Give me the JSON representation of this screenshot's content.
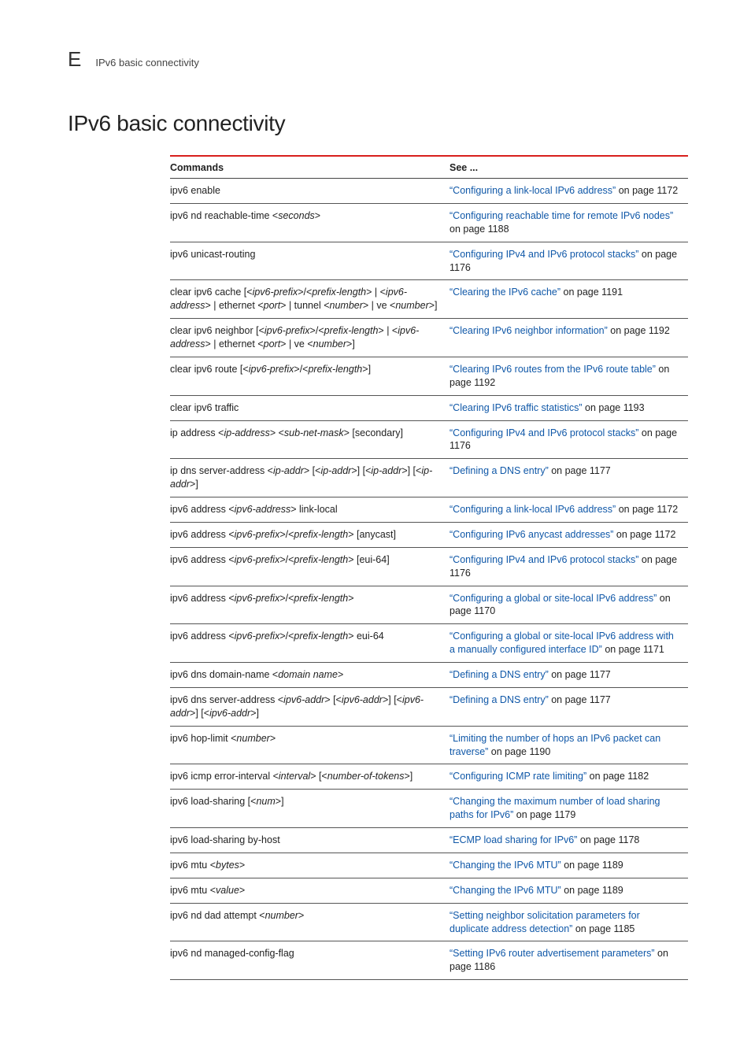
{
  "header": {
    "appendix_letter": "E",
    "subtitle": "IPv6 basic connectivity"
  },
  "title": "IPv6 basic connectivity",
  "table": {
    "headers": {
      "commands": "Commands",
      "see": "See ..."
    },
    "rows": [
      {
        "cmd": [
          {
            "t": "ipv6 enable"
          }
        ],
        "see": [
          {
            "l": "“Configuring a link-local IPv6 address”"
          },
          {
            "t": " on page 1172"
          }
        ]
      },
      {
        "cmd": [
          {
            "t": "ipv6 nd reachable-time <"
          },
          {
            "i": "seconds"
          },
          {
            "t": ">"
          }
        ],
        "see": [
          {
            "l": "“Configuring reachable time for remote IPv6 nodes”"
          },
          {
            "t": " on page 1188"
          }
        ]
      },
      {
        "cmd": [
          {
            "t": "ipv6 unicast-routing"
          }
        ],
        "see": [
          {
            "l": "“Configuring IPv4 and IPv6 protocol stacks”"
          },
          {
            "t": " on page 1176"
          }
        ]
      },
      {
        "cmd": [
          {
            "t": "clear ipv6 cache [<"
          },
          {
            "i": "ipv6-prefix"
          },
          {
            "t": ">/<"
          },
          {
            "i": "prefix-length"
          },
          {
            "t": "> | <"
          },
          {
            "i": "ipv6-address"
          },
          {
            "t": "> | ethernet <"
          },
          {
            "i": "port"
          },
          {
            "t": "> | tunnel <"
          },
          {
            "i": "number"
          },
          {
            "t": "> | ve <"
          },
          {
            "i": "number"
          },
          {
            "t": ">]"
          }
        ],
        "see": [
          {
            "l": "“Clearing the IPv6 cache”"
          },
          {
            "t": " on page 1191"
          }
        ]
      },
      {
        "cmd": [
          {
            "t": "clear ipv6 neighbor [<"
          },
          {
            "i": "ipv6-prefix"
          },
          {
            "t": ">/<"
          },
          {
            "i": "prefix-length"
          },
          {
            "t": "> | <"
          },
          {
            "i": "ipv6-address"
          },
          {
            "t": "> | ethernet <"
          },
          {
            "i": "port"
          },
          {
            "t": "> | ve <"
          },
          {
            "i": "number"
          },
          {
            "t": ">]"
          }
        ],
        "see": [
          {
            "l": "“Clearing IPv6 neighbor information”"
          },
          {
            "t": " on page 1192"
          }
        ]
      },
      {
        "cmd": [
          {
            "t": "clear ipv6 route [<"
          },
          {
            "i": "ipv6-prefix"
          },
          {
            "t": ">/<"
          },
          {
            "i": "prefix-length"
          },
          {
            "t": ">]"
          }
        ],
        "see": [
          {
            "l": "“Clearing IPv6 routes from the IPv6 route table”"
          },
          {
            "t": " on page 1192"
          }
        ]
      },
      {
        "cmd": [
          {
            "t": "clear ipv6 traffic"
          }
        ],
        "see": [
          {
            "l": "“Clearing IPv6 traffic statistics”"
          },
          {
            "t": " on page 1193"
          }
        ]
      },
      {
        "cmd": [
          {
            "t": "ip address <"
          },
          {
            "i": "ip-address"
          },
          {
            "t": "> <"
          },
          {
            "i": "sub-net-mask"
          },
          {
            "t": "> [secondary]"
          }
        ],
        "see": [
          {
            "l": "“Configuring IPv4 and IPv6 protocol stacks”"
          },
          {
            "t": " on page 1176"
          }
        ]
      },
      {
        "cmd": [
          {
            "t": "ip dns server-address <"
          },
          {
            "i": "ip-addr"
          },
          {
            "t": "> [<"
          },
          {
            "i": "ip-addr"
          },
          {
            "t": ">] [<"
          },
          {
            "i": "ip-addr"
          },
          {
            "t": ">] [<"
          },
          {
            "i": "ip-addr"
          },
          {
            "t": ">]"
          }
        ],
        "see": [
          {
            "l": "“Defining a DNS entry”"
          },
          {
            "t": " on page 1177"
          }
        ]
      },
      {
        "cmd": [
          {
            "t": "ipv6 address <"
          },
          {
            "i": "ipv6-address"
          },
          {
            "t": "> link-local"
          }
        ],
        "see": [
          {
            "l": "“Configuring a link-local IPv6 address”"
          },
          {
            "t": " on page 1172"
          }
        ]
      },
      {
        "cmd": [
          {
            "t": "ipv6 address <"
          },
          {
            "i": "ipv6-prefix"
          },
          {
            "t": ">/<"
          },
          {
            "i": "prefix-length"
          },
          {
            "t": "> [anycast]"
          }
        ],
        "see": [
          {
            "l": "“Configuring IPv6 anycast addresses”"
          },
          {
            "t": " on page 1172"
          }
        ]
      },
      {
        "cmd": [
          {
            "t": "ipv6 address <"
          },
          {
            "i": "ipv6-prefix"
          },
          {
            "t": ">/<"
          },
          {
            "i": "prefix-length"
          },
          {
            "t": "> [eui-64]"
          }
        ],
        "see": [
          {
            "l": "“Configuring IPv4 and IPv6 protocol stacks”"
          },
          {
            "t": " on page 1176"
          }
        ]
      },
      {
        "cmd": [
          {
            "t": "ipv6 address <"
          },
          {
            "i": "ipv6-prefix"
          },
          {
            "t": ">/<"
          },
          {
            "i": "prefix-length"
          },
          {
            "t": ">"
          }
        ],
        "see": [
          {
            "l": "“Configuring a global or site-local IPv6 address”"
          },
          {
            "t": " on page 1170"
          }
        ]
      },
      {
        "cmd": [
          {
            "t": "ipv6 address <"
          },
          {
            "i": "ipv6-prefix"
          },
          {
            "t": ">/<"
          },
          {
            "i": "prefix-length"
          },
          {
            "t": "> eui-64"
          }
        ],
        "see": [
          {
            "l": "“Configuring a global or site-local IPv6 address with a manually configured interface ID”"
          },
          {
            "t": " on page 1171"
          }
        ]
      },
      {
        "cmd": [
          {
            "t": "ipv6 dns domain-name <"
          },
          {
            "i": "domain name"
          },
          {
            "t": ">"
          }
        ],
        "see": [
          {
            "l": "“Defining a DNS entry”"
          },
          {
            "t": " on page 1177"
          }
        ]
      },
      {
        "cmd": [
          {
            "t": "ipv6 dns server-address <"
          },
          {
            "i": "ipv6-addr"
          },
          {
            "t": "> [<"
          },
          {
            "i": "ipv6-addr"
          },
          {
            "t": ">] [<"
          },
          {
            "i": "ipv6-addr"
          },
          {
            "t": ">] [<"
          },
          {
            "i": "ipv6-addr"
          },
          {
            "t": ">]"
          }
        ],
        "see": [
          {
            "l": "“Defining a DNS entry”"
          },
          {
            "t": " on page 1177"
          }
        ]
      },
      {
        "cmd": [
          {
            "t": "ipv6 hop-limit <"
          },
          {
            "i": "number"
          },
          {
            "t": ">"
          }
        ],
        "see": [
          {
            "l": "“Limiting the number of hops an IPv6 packet can traverse”"
          },
          {
            "t": " on page 1190"
          }
        ]
      },
      {
        "cmd": [
          {
            "t": "ipv6 icmp error-interval <"
          },
          {
            "i": "interval"
          },
          {
            "t": "> [<"
          },
          {
            "i": "number-of-tokens"
          },
          {
            "t": ">]"
          }
        ],
        "see": [
          {
            "l": "“Configuring ICMP rate limiting”"
          },
          {
            "t": " on page 1182"
          }
        ]
      },
      {
        "cmd": [
          {
            "t": "ipv6 load-sharing [<"
          },
          {
            "i": "num"
          },
          {
            "t": ">]"
          }
        ],
        "see": [
          {
            "l": "“Changing the maximum number of load sharing paths for IPv6”"
          },
          {
            "t": " on page 1179"
          }
        ]
      },
      {
        "cmd": [
          {
            "t": "ipv6 load-sharing by-host"
          }
        ],
        "see": [
          {
            "l": "“ECMP load sharing for IPv6”"
          },
          {
            "t": " on page 1178"
          }
        ]
      },
      {
        "cmd": [
          {
            "t": "ipv6 mtu <"
          },
          {
            "i": "bytes"
          },
          {
            "t": ">"
          }
        ],
        "see": [
          {
            "l": "“Changing the IPv6 MTU”"
          },
          {
            "t": " on page 1189"
          }
        ]
      },
      {
        "cmd": [
          {
            "t": "ipv6 mtu <"
          },
          {
            "i": "value"
          },
          {
            "t": ">"
          }
        ],
        "see": [
          {
            "l": "“Changing the IPv6 MTU”"
          },
          {
            "t": " on page 1189"
          }
        ]
      },
      {
        "cmd": [
          {
            "t": "ipv6 nd dad attempt <"
          },
          {
            "i": "number"
          },
          {
            "t": ">"
          }
        ],
        "see": [
          {
            "l": "“Setting neighbor solicitation parameters for duplicate address detection”"
          },
          {
            "t": " on page 1185"
          }
        ]
      },
      {
        "cmd": [
          {
            "t": "ipv6 nd managed-config-flag"
          }
        ],
        "see": [
          {
            "l": "“Setting IPv6 router advertisement parameters”"
          },
          {
            "t": " on page 1186"
          }
        ]
      }
    ]
  }
}
